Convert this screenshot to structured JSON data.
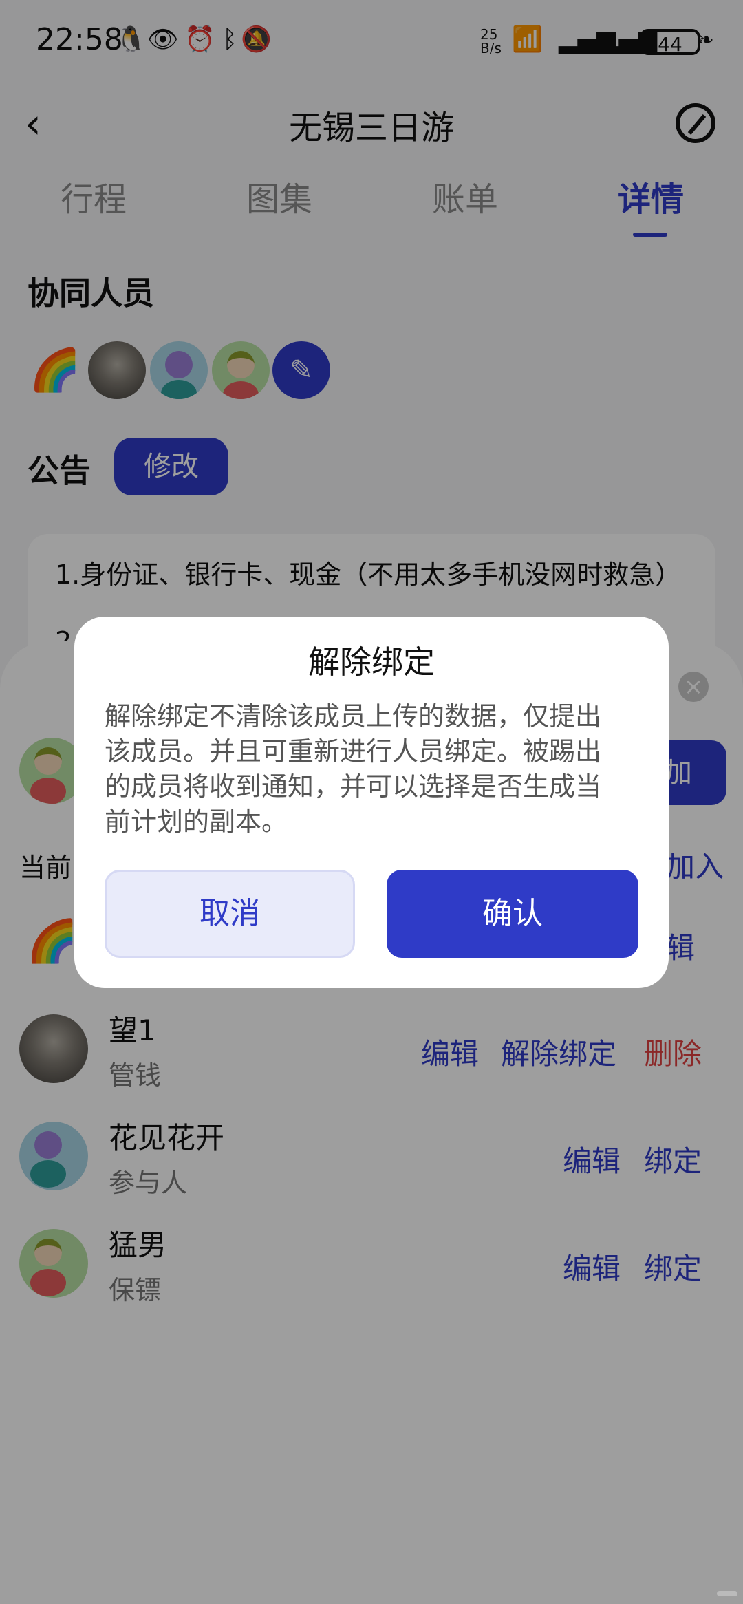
{
  "status_bar": {
    "time": "22:58",
    "net_speed": "25\nB/s",
    "battery": "44",
    "icons": [
      "qq-icon",
      "eye-icon",
      "alarm-icon",
      "bluetooth-icon",
      "mute-icon",
      "wifi-icon",
      "signal-icon",
      "signal-icon-2",
      "leaf-icon"
    ]
  },
  "header": {
    "title": "无锡三日游",
    "back_icon": "chevron-left-icon",
    "edit_icon": "edit-circle-icon"
  },
  "tabs": [
    {
      "label": "行程"
    },
    {
      "label": "图集"
    },
    {
      "label": "账单"
    },
    {
      "label": "详情",
      "active": true
    }
  ],
  "collaborators": {
    "title": "协同人员"
  },
  "notice": {
    "title": "公告",
    "edit_label": "修改",
    "text": "1.身份证、银行卡、现金（不用太多手机没网时救急）",
    "text_partial": "2."
  },
  "sheet": {
    "add_label": "加",
    "current_label": "当前",
    "join_label": "加入",
    "edit_label": "辑",
    "members": [
      {
        "name": "望1",
        "role": "管钱",
        "actions": [
          "编辑",
          "解除绑定",
          "删除"
        ]
      },
      {
        "name": "花见花开",
        "role": "参与人",
        "actions": [
          "编辑",
          "绑定"
        ]
      },
      {
        "name": "猛男",
        "role": "保镖",
        "actions": [
          "编辑",
          "绑定"
        ]
      }
    ]
  },
  "dialog": {
    "title": "解除绑定",
    "message": "解除绑定不清除该成员上传的数据，仅提出该成员。并且可重新进行人员绑定。被踢出的成员将收到通知，并可以选择是否生成当前计划的副本。",
    "cancel": "取消",
    "confirm": "确认"
  },
  "colors": {
    "accent": "#2f3bc7",
    "danger": "#e04141"
  }
}
